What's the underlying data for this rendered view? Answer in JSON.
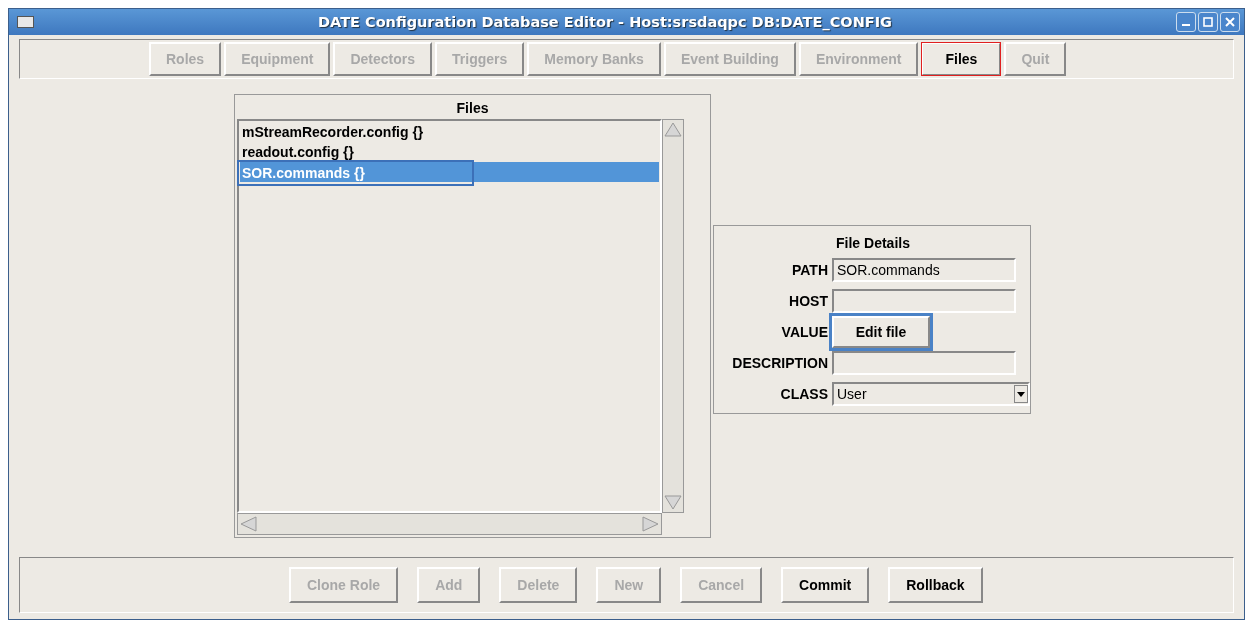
{
  "window": {
    "title": "DATE Configuration Database Editor - Host:srsdaqpc DB:DATE_CONFIG"
  },
  "tabs": [
    {
      "label": "Roles",
      "selected": false,
      "disabled": true
    },
    {
      "label": "Equipment",
      "selected": false,
      "disabled": true
    },
    {
      "label": "Detectors",
      "selected": false,
      "disabled": true
    },
    {
      "label": "Triggers",
      "selected": false,
      "disabled": true
    },
    {
      "label": "Memory Banks",
      "selected": false,
      "disabled": true
    },
    {
      "label": "Event Building",
      "selected": false,
      "disabled": true
    },
    {
      "label": "Environment",
      "selected": false,
      "disabled": true
    },
    {
      "label": "Files",
      "selected": true,
      "disabled": false
    },
    {
      "label": "Quit",
      "selected": false,
      "disabled": true
    }
  ],
  "files_panel": {
    "title": "Files",
    "items": [
      {
        "label": "mStreamRecorder.config {}",
        "selected": false
      },
      {
        "label": "readout.config {}",
        "selected": false
      },
      {
        "label": "SOR.commands {}",
        "selected": true
      }
    ]
  },
  "file_details": {
    "title": "File Details",
    "fields": [
      {
        "kind": "text",
        "label": "PATH",
        "value": "SOR.commands"
      },
      {
        "kind": "text",
        "label": "HOST"
      },
      {
        "kind": "button",
        "label": "VALUE",
        "button": "Edit file",
        "focused": true
      },
      {
        "kind": "text",
        "label": "DESCRIPTION"
      },
      {
        "kind": "select",
        "label": "CLASS",
        "value": "User"
      }
    ]
  },
  "buttons": [
    {
      "label": "Clone Role",
      "disabled": true
    },
    {
      "label": "Add",
      "disabled": true
    },
    {
      "label": "Delete",
      "disabled": true
    },
    {
      "label": "New",
      "disabled": true
    },
    {
      "label": "Cancel",
      "disabled": true
    },
    {
      "label": "Commit",
      "disabled": false
    },
    {
      "label": "Rollback",
      "disabled": false
    }
  ]
}
